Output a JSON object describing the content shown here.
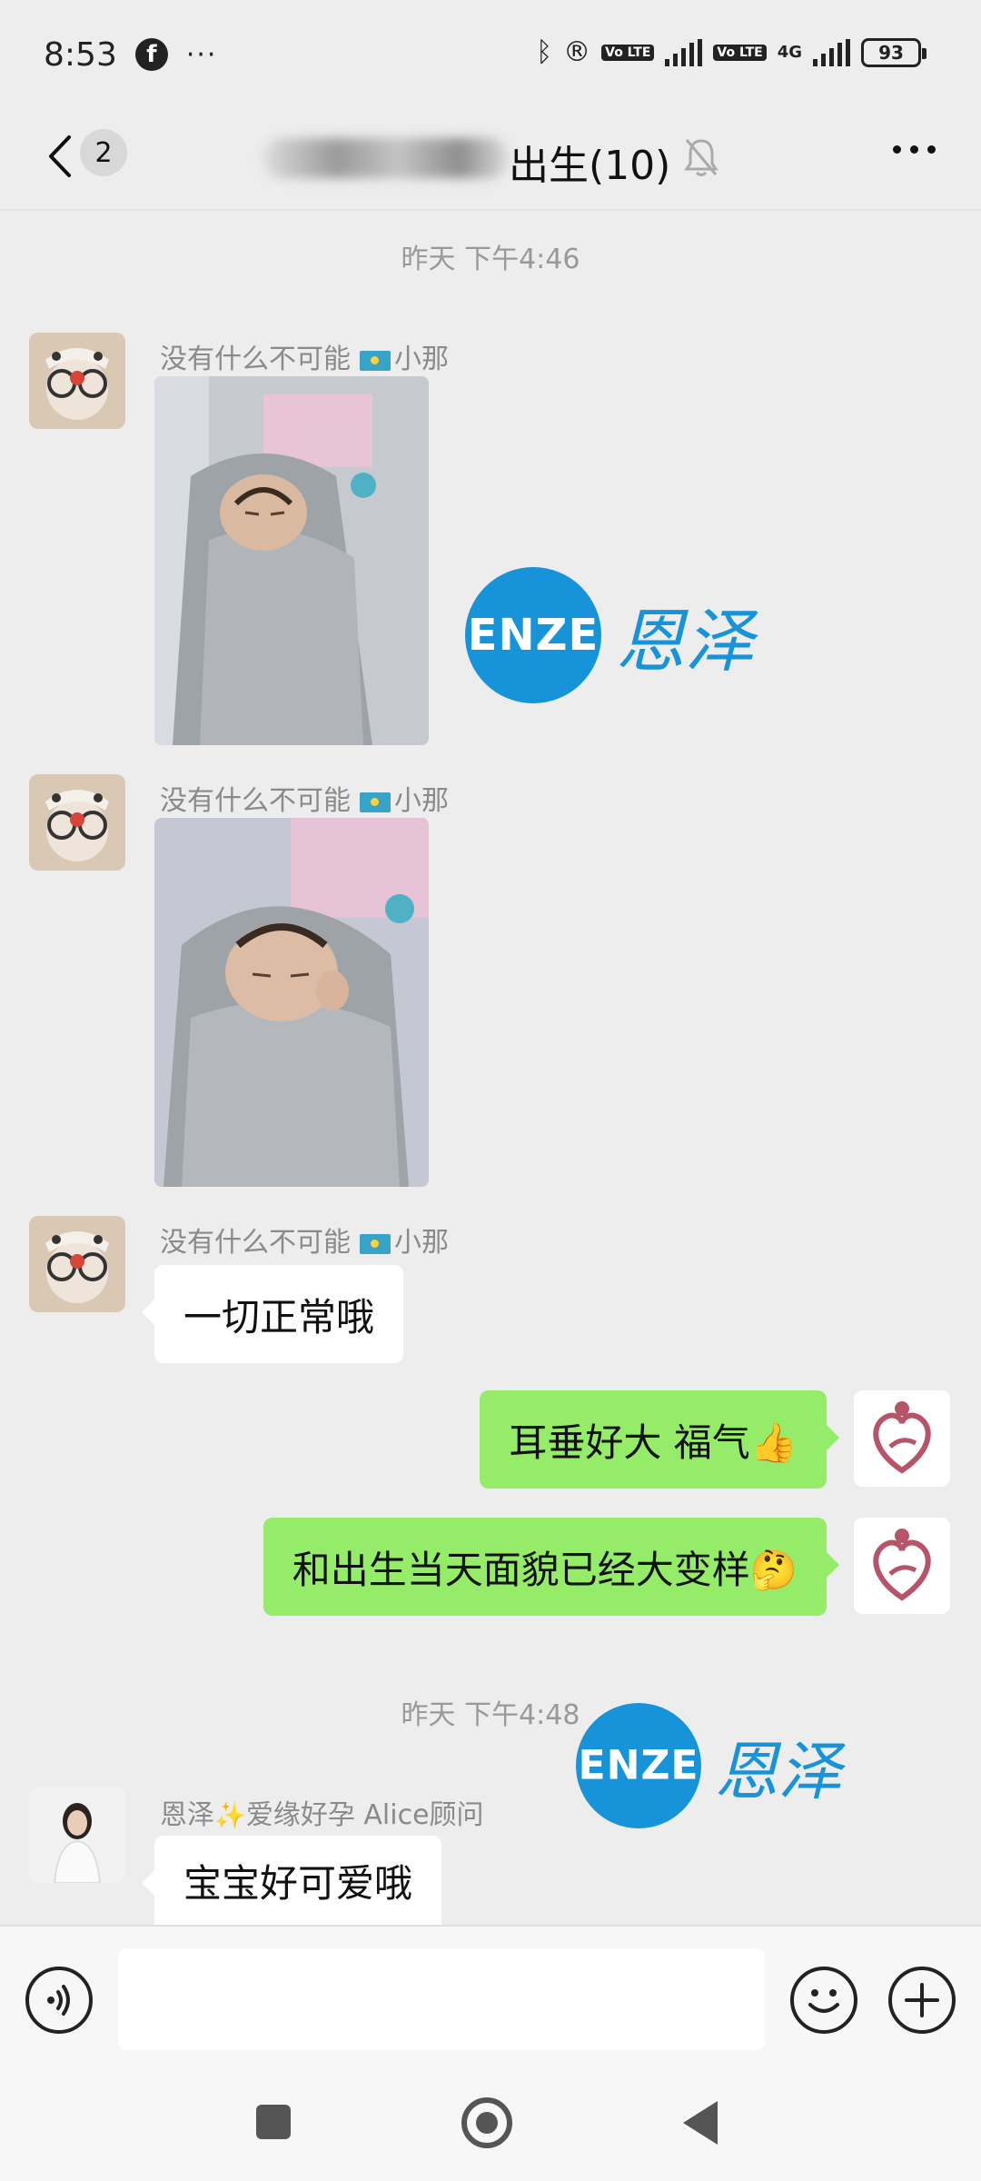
{
  "status_bar": {
    "time": "8:53",
    "more": "···",
    "battery": "93",
    "network": "4G",
    "volte": "Vo LTE"
  },
  "header": {
    "back_label": "<",
    "unread_count": "2",
    "title": "出生(10)"
  },
  "messages": [
    {
      "type": "timestamp",
      "text": "昨天 下午4:46"
    },
    {
      "type": "image",
      "sender": "没有什么不可能",
      "sender_suffix": "小那"
    },
    {
      "type": "image",
      "sender": "没有什么不可能",
      "sender_suffix": "小那"
    },
    {
      "type": "text",
      "sender": "没有什么不可能",
      "sender_suffix": "小那",
      "text": "一切正常哦"
    },
    {
      "type": "text_self",
      "text": "耳垂好大 福气👍"
    },
    {
      "type": "text_self",
      "text": "和出生当天面貌已经大变样🤔"
    },
    {
      "type": "timestamp",
      "text": "昨天 下午4:48"
    },
    {
      "type": "text",
      "sender": "恩泽",
      "sender_suffix": "爱缘好孕 Alice顾问",
      "text": "宝宝好可爱哦"
    }
  ],
  "watermark": {
    "logo_text": "ENZE",
    "cn_text": "恩泽"
  },
  "input": {
    "placeholder": ""
  },
  "colors": {
    "self_bubble": "#95ec69",
    "other_bubble": "#ffffff",
    "background": "#ededed",
    "watermark": "#1793da"
  }
}
